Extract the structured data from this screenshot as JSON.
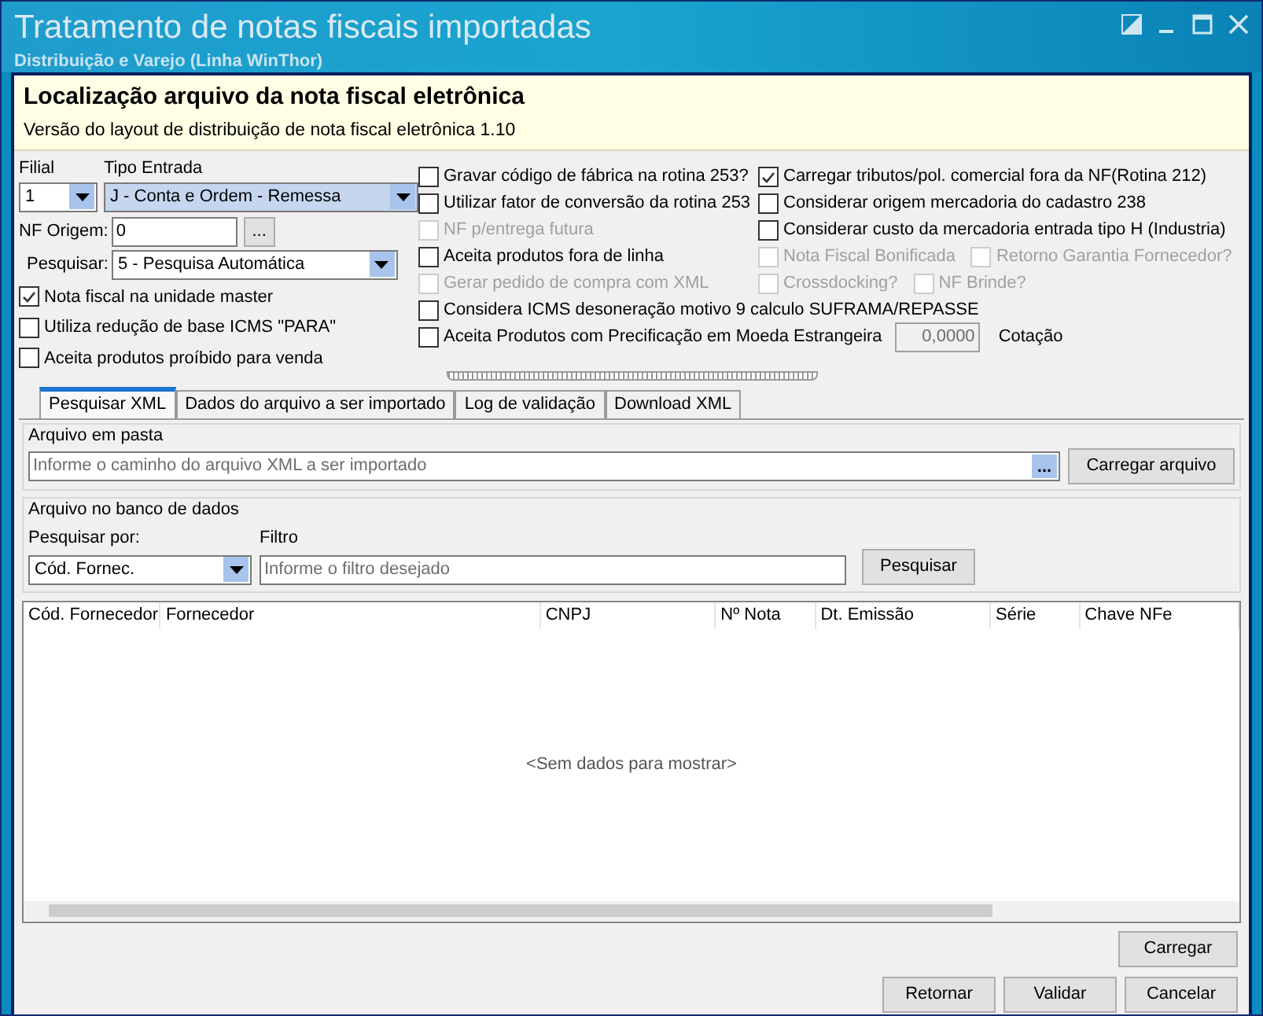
{
  "window": {
    "title": "Tratamento de notas fiscais importadas",
    "subtitle": "Distribuição e Varejo (Linha WinThor)"
  },
  "header": {
    "title": "Localização arquivo da nota fiscal eletrônica",
    "subtitle": "Versão do layout de distribuição de nota fiscal eletrônica 1.10"
  },
  "filial": {
    "label": "Filial",
    "value": "1"
  },
  "tipo_entrada": {
    "label": "Tipo Entrada",
    "value": "J - Conta e Ordem - Remessa"
  },
  "nf_origem": {
    "label": "NF Origem:",
    "value": "0",
    "button": "..."
  },
  "pesquisar": {
    "label": "Pesquisar:",
    "value": "5 - Pesquisa Automática"
  },
  "left_options": [
    {
      "label": "Nota fiscal na unidade master",
      "checked": true,
      "disabled": false
    },
    {
      "label": "Utiliza redução de base ICMS \"PARA\"",
      "checked": false,
      "disabled": false
    },
    {
      "label": "Aceita produtos proíbido para venda",
      "checked": false,
      "disabled": false
    }
  ],
  "option_rows": [
    [
      {
        "kind": "checkbox",
        "label": "Gravar código de fábrica na rotina 253?",
        "checked": false,
        "disabled": false
      },
      {
        "kind": "checkbox",
        "label": "Carregar tributos/pol. comercial fora da NF(Rotina 212)",
        "checked": true,
        "disabled": false
      }
    ],
    [
      {
        "kind": "checkbox",
        "label": "Utilizar fator de conversão da rotina 253",
        "checked": false,
        "disabled": false
      },
      {
        "kind": "checkbox",
        "label": "Considerar origem mercadoria do cadastro 238",
        "checked": false,
        "disabled": false
      }
    ],
    [
      {
        "kind": "checkbox",
        "label": "NF p/entrega futura",
        "checked": false,
        "disabled": true
      },
      {
        "kind": "checkbox",
        "label": "Considerar custo da mercadoria entrada tipo H (Industria)",
        "checked": false,
        "disabled": false
      }
    ],
    [
      {
        "kind": "checkbox",
        "label": "Aceita produtos fora de linha",
        "checked": false,
        "disabled": false
      },
      {
        "kind": "checkbox",
        "label": "Nota Fiscal Bonificada",
        "checked": false,
        "disabled": true
      },
      {
        "kind": "checkbox",
        "label": "Retorno Garantia Fornecedor?",
        "checked": false,
        "disabled": true
      }
    ],
    [
      {
        "kind": "checkbox",
        "label": "Gerar pedido de compra com XML",
        "checked": false,
        "disabled": true
      },
      {
        "kind": "checkbox",
        "label": "Crossdocking?",
        "checked": false,
        "disabled": true
      },
      {
        "kind": "checkbox",
        "label": "NF Brinde?",
        "checked": false,
        "disabled": true
      }
    ],
    [
      {
        "kind": "checkbox",
        "label": "Considera ICMS desoneração motivo 9 calculo SUFRAMA/REPASSE",
        "checked": false,
        "disabled": false
      }
    ],
    [
      {
        "kind": "checkbox",
        "label": "Aceita Produtos com Precificação em Moeda Estrangeira",
        "checked": false,
        "disabled": false
      },
      {
        "kind": "field",
        "value": "0,0000",
        "disabled": true
      },
      {
        "kind": "label",
        "label": "Cotação"
      }
    ]
  ],
  "tabs": [
    {
      "label": "Pesquisar XML",
      "selected": true
    },
    {
      "label": "Dados do arquivo a ser importado",
      "selected": false
    },
    {
      "label": "Log de validação",
      "selected": false
    },
    {
      "label": "Download XML",
      "selected": false
    }
  ],
  "arquivo_em_pasta": {
    "title": "Arquivo em pasta",
    "placeholder": "Informe o caminho do arquivo XML a ser importado",
    "browse": "...",
    "button": "Carregar arquivo"
  },
  "arquivo_no_banco": {
    "title": "Arquivo no banco de dados",
    "search_by_label": "Pesquisar por:",
    "search_by_value": "Cód. Fornec.",
    "filter_label": "Filtro",
    "filter_placeholder": "Informe o filtro desejado",
    "button": "Pesquisar"
  },
  "table": {
    "columns": [
      "Cód. Fornecedor",
      "Fornecedor",
      "CNPJ",
      "Nº Nota",
      "Dt. Emissão",
      "Série",
      "Chave NFe"
    ],
    "empty": "<Sem dados para mostrar>"
  },
  "carregar": "Carregar",
  "buttons": [
    "Retornar",
    "Validar",
    "Cancelar"
  ]
}
